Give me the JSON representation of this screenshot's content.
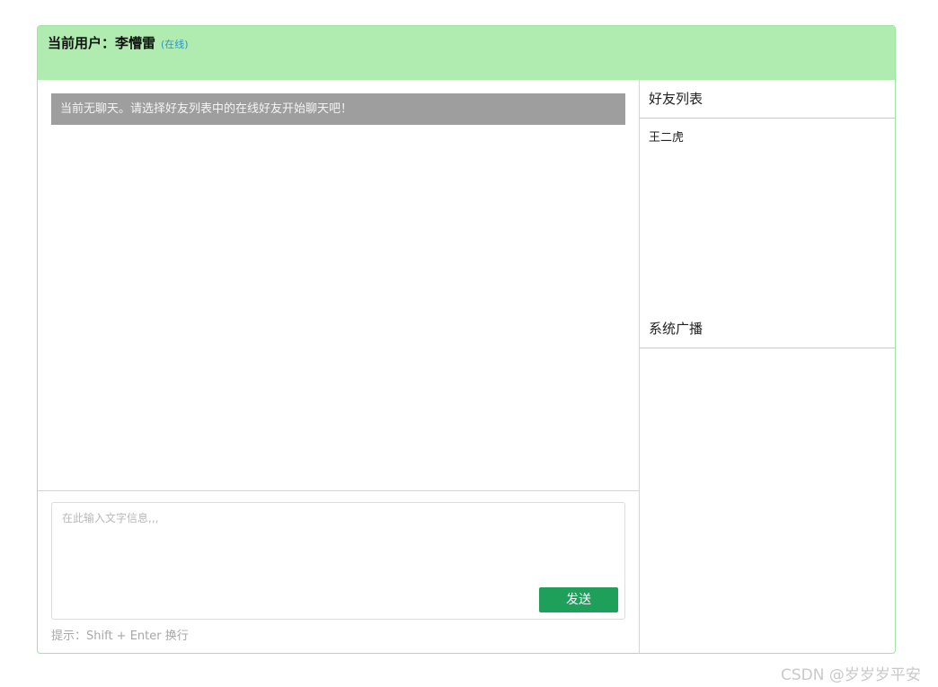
{
  "header": {
    "user_label": "当前用户：李懵雷",
    "status": "(在线)",
    "bg_color": "#b0ecb0"
  },
  "chat": {
    "notice": "当前无聊天。请选择好友列表中的在线好友开始聊天吧！",
    "input_placeholder": "在此输入文字信息,,,",
    "send_label": "发送",
    "hint": "提示：Shift + Enter 换行",
    "send_color": "#1e9f5a"
  },
  "sidebar": {
    "friends_title": "好友列表",
    "friends": [
      "王二虎"
    ],
    "broadcast_title": "系统广播"
  },
  "watermark": "CSDN @岁岁岁平安"
}
